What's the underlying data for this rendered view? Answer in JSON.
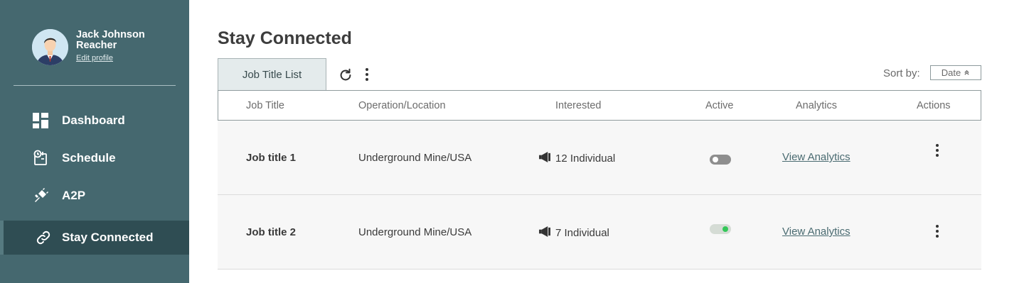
{
  "profile": {
    "name": "Jack Johnson Reacher",
    "edit_label": "Edit profile"
  },
  "nav": {
    "items": [
      {
        "label": "Dashboard",
        "icon": "dashboard-icon"
      },
      {
        "label": "Schedule",
        "icon": "schedule-icon"
      },
      {
        "label": "A2P",
        "icon": "plug-icon"
      },
      {
        "label": "Stay Connected",
        "icon": "link-icon",
        "active": true
      }
    ]
  },
  "page": {
    "title": "Stay Connected",
    "tab_label": "Job Title List",
    "sort_label": "Sort by:",
    "sort_value": "Date"
  },
  "table": {
    "headers": [
      "Job Title",
      "Operation/Location",
      "Interested",
      "Active",
      "Analytics",
      "Actions"
    ],
    "rows": [
      {
        "job_title": "Job title 1",
        "location": "Underground Mine/USA",
        "interested": "12 Individual",
        "active": false,
        "analytics": "View Analytics"
      },
      {
        "job_title": "Job title 2",
        "location": "Underground Mine/USA",
        "interested": "7 Individual",
        "active": true,
        "analytics": "View Analytics"
      }
    ]
  },
  "colors": {
    "sidebar_bg": "#45686f",
    "sidebar_active": "#2f4d53",
    "tab_bg": "#e4ebec",
    "toggle_on": "#34c759",
    "link": "#4a6b71"
  }
}
